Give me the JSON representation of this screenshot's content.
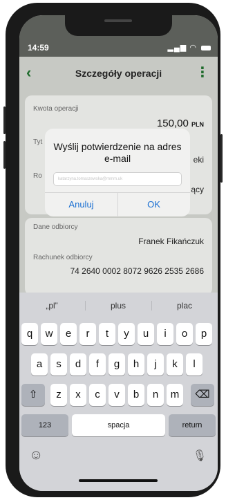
{
  "status": {
    "time": "14:59",
    "signal": "..ıl"
  },
  "header": {
    "title": "Szczegóły operacji",
    "back": "‹",
    "more": "⋮"
  },
  "details": {
    "amount_label": "Kwota operacji",
    "amount_value": "150,00",
    "amount_currency": "PLN",
    "title_label_partial": "Tyt",
    "title_value_partial": "eki",
    "date_label_partial": "Ro",
    "date_value_partial": "ący",
    "recipient_label": "Dane odbiorcy",
    "recipient_value": "Franek Fikańczuk",
    "account_label": "Rachunek odbiorcy",
    "account_value": "74 2640 0002 8072 9626 2535 2686"
  },
  "dialog": {
    "title": "Wyślij potwierdzenie na adres e-mail",
    "input_value": "katarzyna.tomaszewska@mmm.uk",
    "cancel": "Anuluj",
    "ok": "OK"
  },
  "keyboard": {
    "suggestions": [
      "„pl”",
      "plus",
      "plac"
    ],
    "row1": [
      "q",
      "w",
      "e",
      "r",
      "t",
      "y",
      "u",
      "i",
      "o",
      "p"
    ],
    "row2": [
      "a",
      "s",
      "d",
      "f",
      "g",
      "h",
      "j",
      "k",
      "l"
    ],
    "row3": [
      "z",
      "x",
      "c",
      "v",
      "b",
      "n",
      "m"
    ],
    "shift": "⇧",
    "backspace": "⌫",
    "numbers": "123",
    "space": "spacja",
    "return": "return",
    "emoji": "☺",
    "mic": "🎙"
  }
}
